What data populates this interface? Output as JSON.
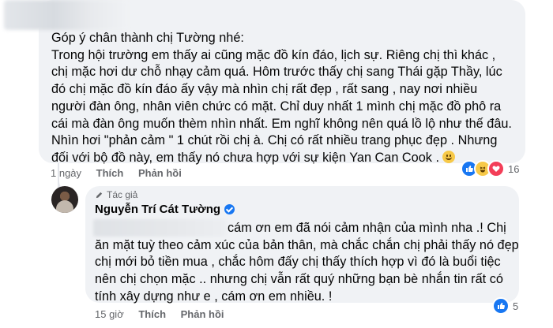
{
  "comment1": {
    "lines": [
      "Góp ý chân thành chị Tường nhé:",
      "Trong hội trường em thấy ai cũng mặc đồ kín đáo, lịch sự. Riêng chị thì khác ,",
      "chị mặc hơi dư chỗ nhạy cảm quá. Hôm trước thấy chị sang Thái gặp Thầy, lúc",
      "đó chị mặc đồ kín đáo ấy vậy mà nhìn chị rất đẹp , rất sang , nay nơi nhiều",
      "người đàn ông, nhân viên chức có mặt. Chỉ duy nhất 1 mình chị mặc đồ phô ra",
      "cái mà đàn ông muốn thèm nhìn nhất. Em nghĩ không nên quá lồ lộ như thế đâu.",
      "Nhìn hơi \"phản cảm \" 1 chút rồi chị à. Chị có rất nhiều trang phục đẹp . Nhưng",
      "đối với bộ đồ này, em thấy nó chưa hợp với sự kiện Yan Can Cook ."
    ],
    "emoji": "slightly-smiling-face",
    "time": "1 ngày",
    "like_label": "Thích",
    "reply_label": "Phản hồi",
    "reaction_icons": [
      "like-icon",
      "haha-icon",
      "love-icon"
    ],
    "reaction_count": "16"
  },
  "reply": {
    "author_badge": "Tác giả",
    "author_name": "Nguyễn Trí Cát Tường",
    "lines": [
      "cám ơn em đã nói cảm nhận của mình nha .! Chị",
      "ăn mặt tuỳ theo cảm xúc của bản thân, mà chắc chắn chị phải thấy nó đẹp",
      "chị mới bỏ tiền mua , chắc hôm đấy chị thấy thích hợp vì đó là buổi tiệc",
      "nên chị chọn mặc .. nhưng chị vẫn rất quý những bạn bè nhắn tin rất có",
      "tính xây dựng như e , cám ơn em nhiều. !"
    ],
    "time": "15 giờ",
    "like_label": "Thích",
    "reply_label": "Phản hồi",
    "reaction_icons": [
      "like-icon"
    ],
    "reaction_count": "5"
  },
  "colors": {
    "bubble": "#f0f2f5",
    "meta_text": "#65676b",
    "like_blue": "#1877f2",
    "love_red": "#f33e58",
    "haha_yellow": "#f7c948"
  }
}
